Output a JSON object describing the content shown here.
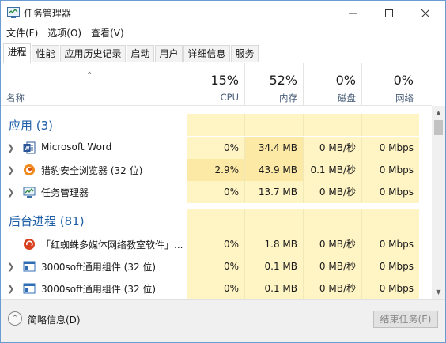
{
  "window": {
    "title": "任务管理器"
  },
  "menu": [
    "文件(F)",
    "选项(O)",
    "查看(V)"
  ],
  "tabs": [
    "进程",
    "性能",
    "应用历史记录",
    "启动",
    "用户",
    "详细信息",
    "服务"
  ],
  "active_tab": "进程",
  "columns": {
    "name": "名称",
    "cpu": {
      "pct": "15%",
      "label": "CPU"
    },
    "mem": {
      "pct": "52%",
      "label": "内存"
    },
    "disk": {
      "pct": "0%",
      "label": "磁盘"
    },
    "net": {
      "pct": "0%",
      "label": "网络"
    }
  },
  "sections": {
    "apps": "应用 (3)",
    "background": "后台进程 (81)"
  },
  "apps": [
    {
      "name": "Microsoft Word",
      "cpu": "0%",
      "mem": "34.4 MB",
      "disk": "0 MB/秒",
      "net": "0 Mbps",
      "icon": "word-icon"
    },
    {
      "name": "猎豹安全浏览器 (32 位)",
      "cpu": "2.9%",
      "mem": "43.9 MB",
      "disk": "0.1 MB/秒",
      "net": "0 Mbps",
      "icon": "liebao-browser-icon"
    },
    {
      "name": "任务管理器",
      "cpu": "0%",
      "mem": "13.7 MB",
      "disk": "0 MB/秒",
      "net": "0 Mbps",
      "icon": "task-manager-icon"
    }
  ],
  "background": [
    {
      "name": "「红蜘蛛多媒体网络教室软件」...",
      "cpu": "0%",
      "mem": "1.8 MB",
      "disk": "0 MB/秒",
      "net": "0 Mbps",
      "icon": "red-spider-icon"
    },
    {
      "name": "3000soft通用组件 (32 位)",
      "cpu": "0%",
      "mem": "0.1 MB",
      "disk": "0 MB/秒",
      "net": "0 Mbps",
      "icon": "app-window-icon"
    },
    {
      "name": "3000soft通用组件 (32 位)",
      "cpu": "0%",
      "mem": "0.1 MB",
      "disk": "0 MB/秒",
      "net": "0 Mbps",
      "icon": "app-window-icon"
    }
  ],
  "footer": {
    "fewer_details": "简略信息(D)",
    "end_task": "结束任务(E)"
  },
  "colors": {
    "section_blue": "#1e5fa8",
    "heat_light": "#fff4c4",
    "heat_medium": "#fde9a6"
  }
}
